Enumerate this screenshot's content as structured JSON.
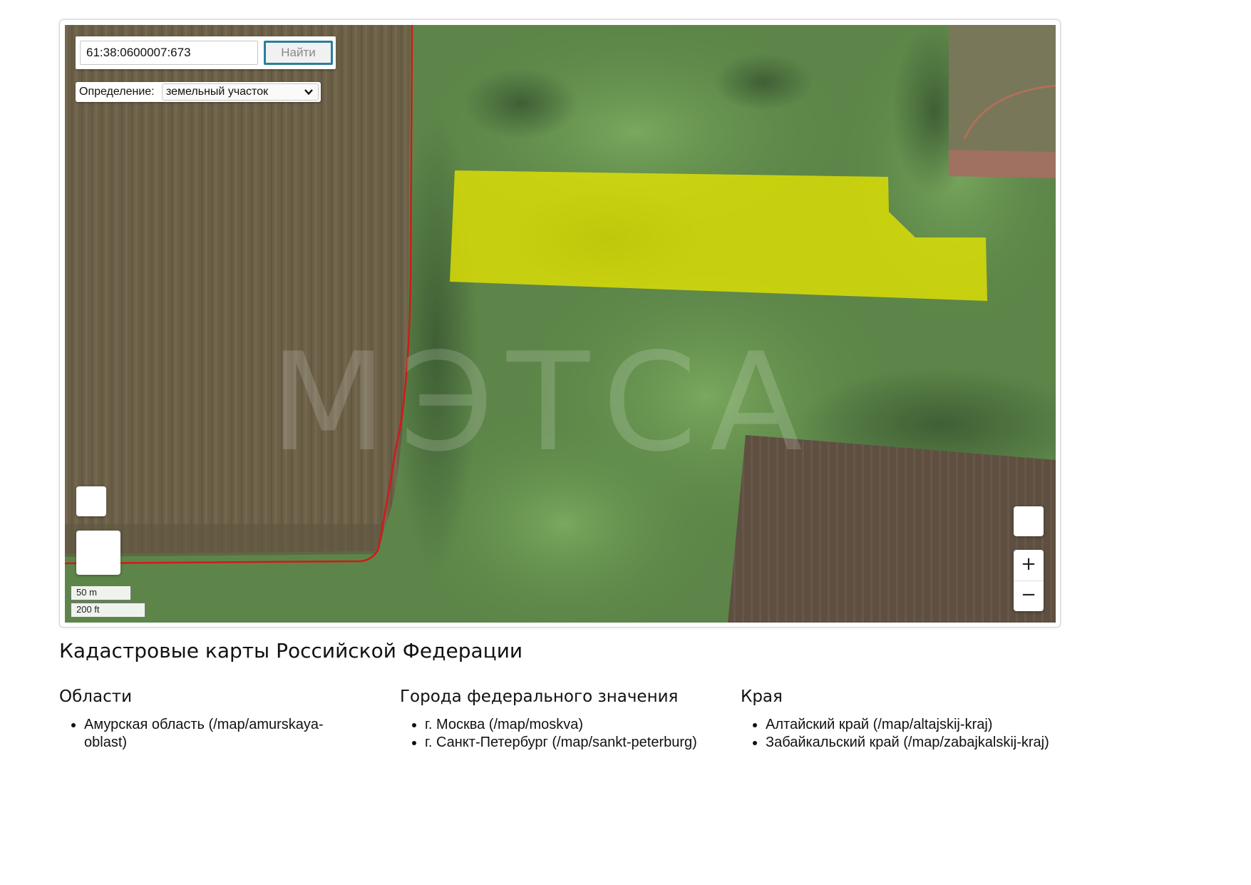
{
  "map": {
    "search": {
      "value": "61:38:0600007:673",
      "button_label": "Найти"
    },
    "definition": {
      "label": "Определение:",
      "selected": "земельный участок"
    },
    "watermark": "МЭТСА",
    "zoom": {
      "in_label": "+",
      "out_label": "−"
    },
    "scale": {
      "metric": "50 m",
      "imperial": "200 ft"
    },
    "colors": {
      "parcel_fill": "#e6e600",
      "boundary_line": "#d11a1a",
      "field": "#6e6248",
      "vegetation": "#5f8a4a"
    }
  },
  "page": {
    "title": "Кадастровые карты Российской Федерации"
  },
  "sections": [
    {
      "heading": "Области",
      "items": [
        "Амурская область (/map/amurskaya-oblast)"
      ]
    },
    {
      "heading": "Города федерального значения",
      "items": [
        "г. Москва (/map/moskva)",
        "г. Санкт-Петербург (/map/sankt-peterburg)"
      ]
    },
    {
      "heading": "Края",
      "items": [
        "Алтайский край (/map/altajskij-kraj)",
        "Забайкальский край (/map/zabajkalskij-kraj)"
      ]
    }
  ]
}
